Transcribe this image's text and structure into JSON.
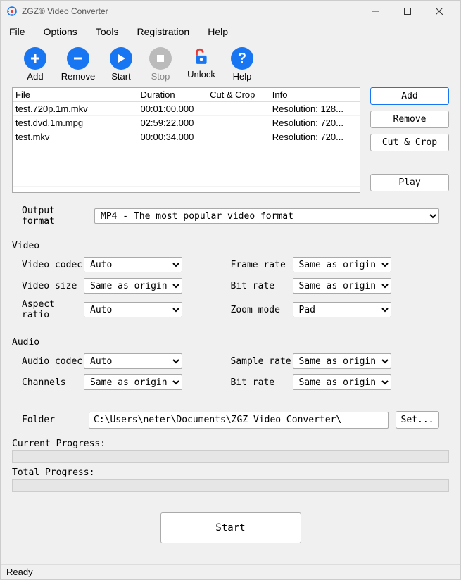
{
  "window": {
    "title": "ZGZ® Video Converter"
  },
  "menubar": [
    "File",
    "Options",
    "Tools",
    "Registration",
    "Help"
  ],
  "toolbar": [
    {
      "label": "Add",
      "name": "add"
    },
    {
      "label": "Remove",
      "name": "remove"
    },
    {
      "label": "Start",
      "name": "start"
    },
    {
      "label": "Stop",
      "name": "stop"
    },
    {
      "label": "Unlock",
      "name": "unlock"
    },
    {
      "label": "Help",
      "name": "help"
    }
  ],
  "fileTable": {
    "headers": [
      "File",
      "Duration",
      "Cut & Crop",
      "Info"
    ],
    "rows": [
      {
        "file": "test.720p.1m.mkv",
        "duration": "00:01:00.000",
        "cut": "",
        "info": "Resolution: 128..."
      },
      {
        "file": "test.dvd.1m.mpg",
        "duration": "02:59:22.000",
        "cut": "",
        "info": "Resolution: 720..."
      },
      {
        "file": "test.mkv",
        "duration": "00:00:34.000",
        "cut": "",
        "info": "Resolution: 720..."
      }
    ]
  },
  "sideButtons": {
    "add": "Add",
    "remove": "Remove",
    "cutcrop": "Cut & Crop",
    "play": "Play"
  },
  "outputFormat": {
    "label": "Output format",
    "value": "MP4 - The most popular video format"
  },
  "video": {
    "title": "Video",
    "codec": {
      "label": "Video codec",
      "value": "Auto"
    },
    "size": {
      "label": "Video size",
      "value": "Same as original vid"
    },
    "aspect": {
      "label": "Aspect ratio",
      "value": "Auto"
    },
    "framerate": {
      "label": "Frame rate",
      "value": "Same as original vid"
    },
    "bitrate": {
      "label": "Bit rate",
      "value": "Same as original vid"
    },
    "zoom": {
      "label": "Zoom mode",
      "value": "Pad"
    }
  },
  "audio": {
    "title": "Audio",
    "codec": {
      "label": "Audio codec",
      "value": "Auto"
    },
    "channels": {
      "label": "Channels",
      "value": "Same as original aud"
    },
    "samplerate": {
      "label": "Sample rate",
      "value": "Same as original aud"
    },
    "bitrate": {
      "label": "Bit rate",
      "value": "Same as original aud"
    }
  },
  "folder": {
    "label": "Folder",
    "value": "C:\\Users\\neter\\Documents\\ZGZ Video Converter\\",
    "setBtn": "Set..."
  },
  "progress": {
    "current": "Current Progress:",
    "total": "Total Progress:"
  },
  "startBtn": "Start",
  "status": "Ready"
}
